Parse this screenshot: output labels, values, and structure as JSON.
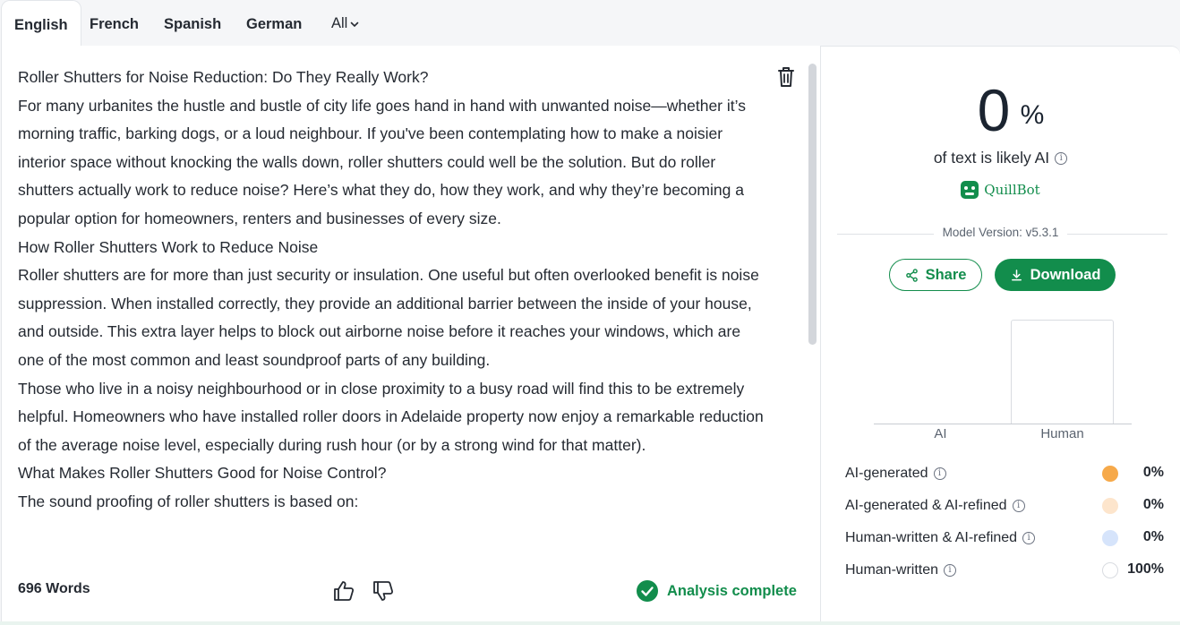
{
  "tabs": {
    "english": "English",
    "french": "French",
    "spanish": "Spanish",
    "german": "German",
    "all": "All"
  },
  "editor": {
    "paragraphs": [
      "Roller Shutters for Noise Reduction: Do They Really Work?",
      "For many urbanites the hustle and bustle of city life goes hand in hand with unwanted noise—whether it’s morning traffic, barking dogs, or a loud neighbour. If you've been contemplating how to make a noisier interior space without knocking the walls down, roller shutters could well be the solution. But do roller shutters actually work to reduce noise? Here’s what they do, how they work, and why they’re becoming a popular option for homeowners, renters and businesses of every size.",
      "How Roller Shutters Work to Reduce Noise",
      "Roller shutters are for more than just security or insulation. One useful but often overlooked benefit is noise suppression. When installed correctly, they provide an additional barrier between the inside of your house, and outside. This extra layer helps to block out airborne noise before it reaches your windows, which are one of the most common and least soundproof parts of any building.",
      "Those who live in a noisy neighbourhood or in close proximity to a busy road will find this to be extremely helpful. Homeowners who have installed roller doors in Adelaide property now enjoy a remarkable reduction of the average noise level, especially during rush hour (or by a strong wind for that matter).",
      "What Makes Roller Shutters Good for Noise Control?",
      "The sound proofing of roller shutters is based on:"
    ],
    "word_count": "696 Words",
    "status": "Analysis complete"
  },
  "results": {
    "percent": "0",
    "percent_symbol": "%",
    "likely_text": "of text is likely AI",
    "brand": "QuillBot",
    "model_version": "Model Version: v5.3.1",
    "share_label": "Share",
    "download_label": "Download"
  },
  "chart_data": {
    "type": "bar",
    "categories": [
      "AI",
      "Human"
    ],
    "values": [
      0,
      100
    ],
    "ylim": [
      0,
      100
    ]
  },
  "legend": [
    {
      "label": "AI-generated",
      "value": "0%",
      "color": "#f6a94a"
    },
    {
      "label": "AI-generated & AI-refined",
      "value": "0%",
      "color": "#fde5cc"
    },
    {
      "label": "Human-written & AI-refined",
      "value": "0%",
      "color": "#d6e4fb"
    },
    {
      "label": "Human-written",
      "value": "100%",
      "color": "#ffffff"
    }
  ],
  "colors": {
    "brand_green": "#128d4c"
  }
}
